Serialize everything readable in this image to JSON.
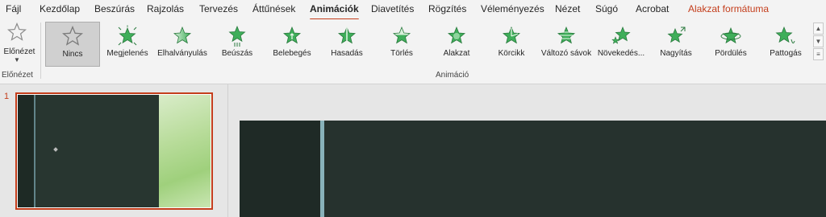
{
  "tabs": [
    {
      "label": "Fájl"
    },
    {
      "label": "Kezdőlap"
    },
    {
      "label": "Beszúrás"
    },
    {
      "label": "Rajzolás"
    },
    {
      "label": "Tervezés"
    },
    {
      "label": "Áttűnések"
    },
    {
      "label": "Animációk"
    },
    {
      "label": "Diavetítés"
    },
    {
      "label": "Rögzítés"
    },
    {
      "label": "Véleményezés"
    },
    {
      "label": "Nézet"
    },
    {
      "label": "Súgó"
    },
    {
      "label": "Acrobat"
    },
    {
      "label": "Alakzat formátuma"
    }
  ],
  "ribbon": {
    "preview": {
      "button_label": "Előnézet",
      "group_label": "Előnézet"
    },
    "animation_group_label": "Animáció",
    "animations": [
      {
        "label": "Nincs",
        "icon": "star-outline-icon"
      },
      {
        "label": "Megjelenés",
        "icon": "star-appear-icon"
      },
      {
        "label": "Elhalványulás",
        "icon": "star-fade-icon"
      },
      {
        "label": "Beúszás",
        "icon": "star-fly-in-icon"
      },
      {
        "label": "Belebegés",
        "icon": "star-float-in-icon"
      },
      {
        "label": "Hasadás",
        "icon": "star-split-icon"
      },
      {
        "label": "Törlés",
        "icon": "star-wipe-icon"
      },
      {
        "label": "Alakzat",
        "icon": "star-shape-icon"
      },
      {
        "label": "Körcikk",
        "icon": "star-wheel-icon"
      },
      {
        "label": "Változó sávok",
        "icon": "star-random-bars-icon"
      },
      {
        "label": "Növekedés...",
        "icon": "star-grow-turn-icon"
      },
      {
        "label": "Nagyítás",
        "icon": "star-zoom-icon"
      },
      {
        "label": "Pördülés",
        "icon": "star-swivel-icon"
      },
      {
        "label": "Pattogás",
        "icon": "star-bounce-icon"
      }
    ],
    "selected_animation": "Nincs"
  },
  "slides": {
    "thumbnail_number": "1"
  },
  "colors": {
    "accent": "#c43e1c",
    "star_green": "#3fae5a",
    "slide_bg": "#26322e"
  }
}
